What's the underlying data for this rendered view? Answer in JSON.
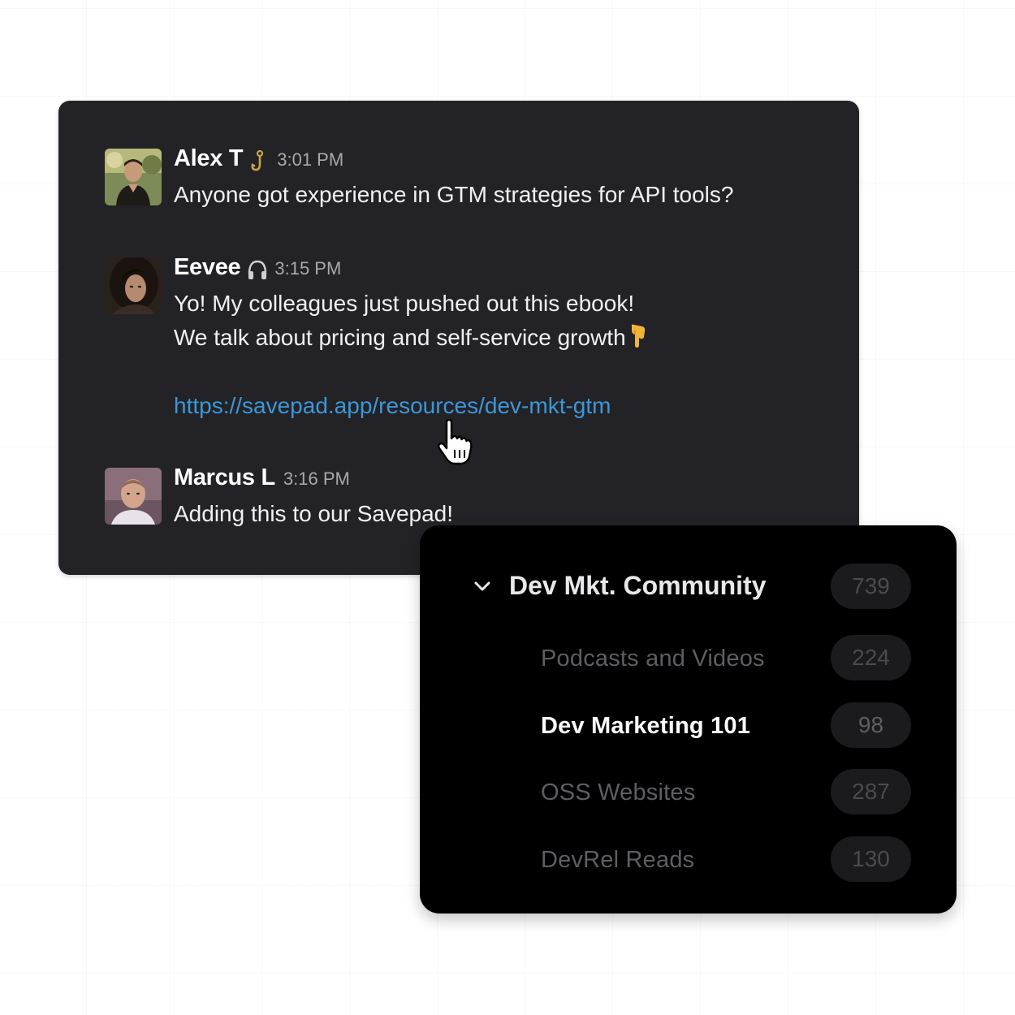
{
  "chat": {
    "messages": [
      {
        "author": "Alex T",
        "status_icon": "fishing-hook-icon",
        "time": "3:01 PM",
        "lines": [
          "Anyone got experience in GTM strategies for API tools?"
        ]
      },
      {
        "author": "Eevee",
        "status_icon": "headphones-icon",
        "time": "3:15 PM",
        "lines": [
          "Yo! My colleagues just pushed out this ebook!",
          "We talk about pricing and self-service growth"
        ],
        "trailing_icon": "pointing-down-icon",
        "link": "https://savepad.app/resources/dev-mkt-gtm"
      },
      {
        "author": "Marcus L",
        "time": "3:16 PM",
        "lines": [
          "Adding this to our Savepad!"
        ]
      }
    ],
    "link_color": "#3d97d6",
    "background": "#232327"
  },
  "collections": {
    "parent": {
      "label": "Dev Mkt. Community",
      "count": "739",
      "expanded": true
    },
    "children": [
      {
        "label": "Podcasts and Videos",
        "count": "224",
        "active": false
      },
      {
        "label": "Dev Marketing 101",
        "count": "98",
        "active": true
      },
      {
        "label": "OSS Websites",
        "count": "287",
        "active": false
      },
      {
        "label": "DevRel Reads",
        "count": "130",
        "active": false
      }
    ]
  }
}
